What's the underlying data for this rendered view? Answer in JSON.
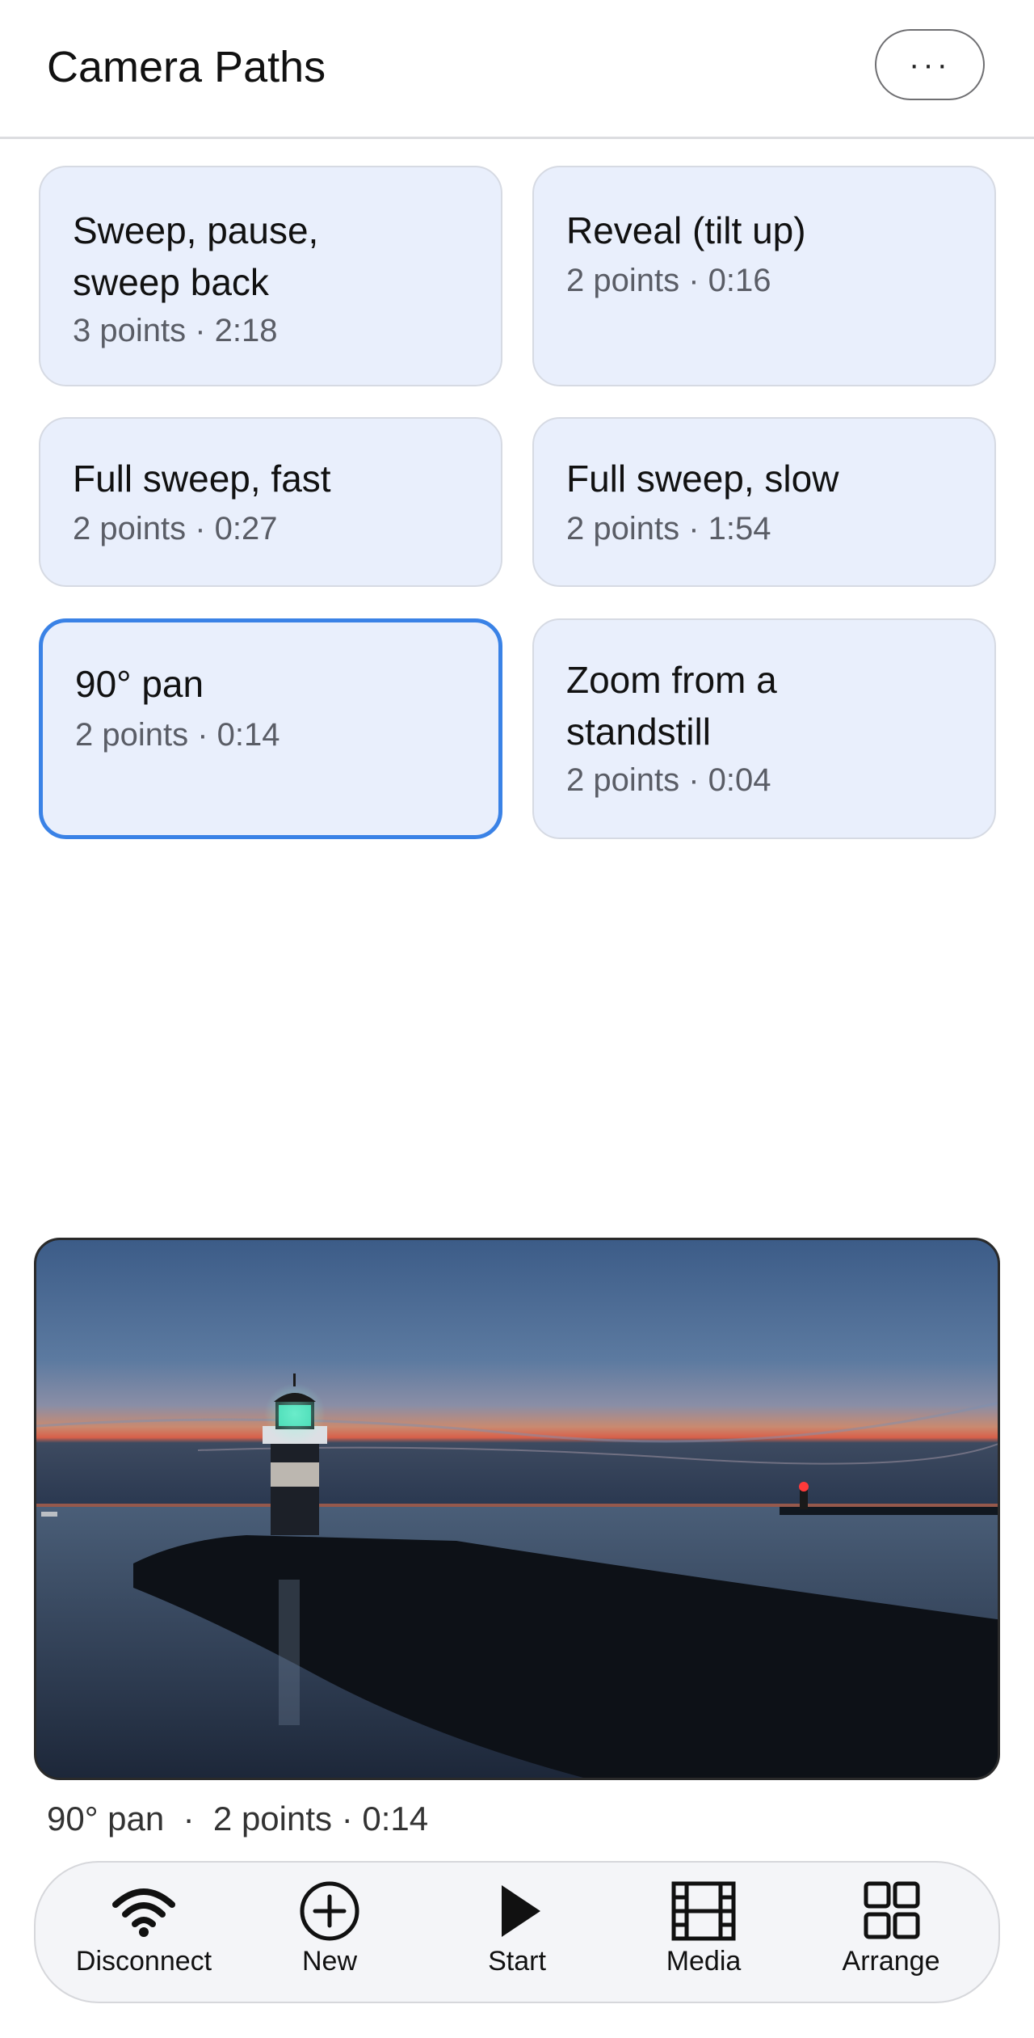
{
  "header": {
    "title": "Camera Paths",
    "more_label": "···"
  },
  "paths": [
    {
      "title": "Sweep, pause, sweep back",
      "meta": "3 points · 2:18",
      "selected": false
    },
    {
      "title": "Reveal (tilt up)",
      "meta": "2 points · 0:16",
      "selected": false
    },
    {
      "title": "Full sweep, fast",
      "meta": "2 points · 0:27",
      "selected": false
    },
    {
      "title": "Full sweep, slow",
      "meta": "2 points · 1:54",
      "selected": false
    },
    {
      "title": "90° pan",
      "meta": "2 points · 0:14",
      "selected": true
    },
    {
      "title": "Zoom from a standstill",
      "meta": "2 points · 0:04",
      "selected": false
    }
  ],
  "preview": {
    "caption": "90° pan  ·  2 points · 0:14"
  },
  "toolbar": {
    "disconnect_label": "Disconnect",
    "new_label": "New",
    "start_label": "Start",
    "media_label": "Media",
    "arrange_label": "Arrange"
  },
  "colors": {
    "accent": "#3a82e6",
    "card_bg": "#e9effc"
  }
}
